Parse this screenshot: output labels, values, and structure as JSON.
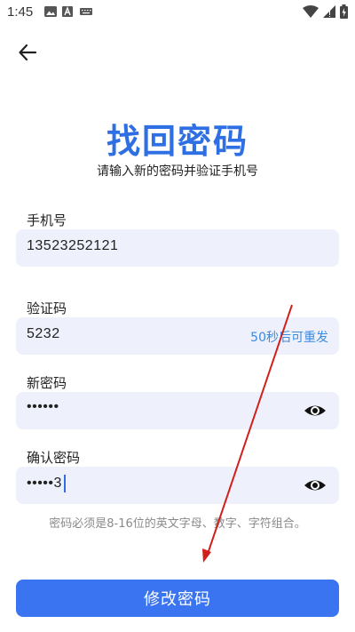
{
  "status_bar": {
    "time": "1:45"
  },
  "header": {
    "back_icon": "arrow-left-icon"
  },
  "title": "找回密码",
  "subtitle": "请输入新的密码并验证手机号",
  "form": {
    "phone": {
      "label": "手机号",
      "value": "13523252121"
    },
    "code": {
      "label": "验证码",
      "value": "5232",
      "resend_label": "50秒后可重发"
    },
    "new_password": {
      "label": "新密码",
      "value": "••••••",
      "toggle_icon": "eye-icon"
    },
    "confirm_password": {
      "label": "确认密码",
      "value": "•••••3",
      "toggle_icon": "eye-icon"
    }
  },
  "hint": "密码必须是8-16位的英文字母、数字、字符组合。",
  "submit_label": "修改密码",
  "colors": {
    "accent": "#2f6fe4",
    "button": "#3b74f0",
    "field_bg": "#eef1fb",
    "resend": "#3a8be0",
    "annotation_arrow": "#d0201c"
  }
}
